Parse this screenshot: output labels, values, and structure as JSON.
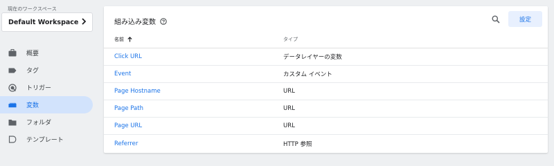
{
  "workspace": {
    "caption": "現在のワークスペース",
    "name": "Default Workspace"
  },
  "nav": {
    "items": [
      {
        "label": "概要",
        "icon": "briefcase-icon",
        "active": false
      },
      {
        "label": "タグ",
        "icon": "tag-icon",
        "active": false
      },
      {
        "label": "トリガー",
        "icon": "trigger-icon",
        "active": false
      },
      {
        "label": "変数",
        "icon": "variables-icon",
        "active": true
      },
      {
        "label": "フォルダ",
        "icon": "folder-icon",
        "active": false
      },
      {
        "label": "テンプレート",
        "icon": "template-icon",
        "active": false
      }
    ]
  },
  "main": {
    "title": "組み込み変数",
    "settings_label": "設定",
    "table": {
      "headers": {
        "name": "名前",
        "type": "タイプ"
      },
      "rows": [
        {
          "name": "Click URL",
          "type": "データレイヤーの変数"
        },
        {
          "name": "Event",
          "type": "カスタム イベント"
        },
        {
          "name": "Page Hostname",
          "type": "URL"
        },
        {
          "name": "Page Path",
          "type": "URL"
        },
        {
          "name": "Page URL",
          "type": "URL"
        },
        {
          "name": "Referrer",
          "type": "HTTP 参照"
        }
      ]
    }
  },
  "colors": {
    "accent": "#1a73e8",
    "active_nav_bg": "#d2e3fc",
    "settings_bg": "#e8f0fe",
    "sidebar_bg": "#eef0f2"
  }
}
